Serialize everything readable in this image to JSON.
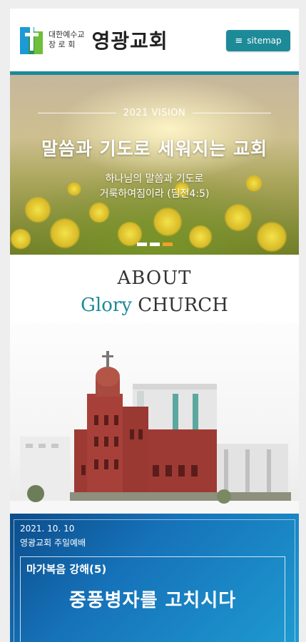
{
  "header": {
    "logo_sub_line1": "대한예수교",
    "logo_sub_line2": "장 로 회",
    "logo_name": "영광교회",
    "sitemap_label": "sitemap"
  },
  "hero": {
    "vision_label": "2021 VISION",
    "title": "말씀과 기도로 세워지는 교회",
    "subtitle_line1": "하나님의 말씀과 기도로",
    "subtitle_line2": "거룩하여짐이라 (딤전4:5)",
    "slide_count": 3,
    "active_slide": 3
  },
  "about": {
    "line1": "ABOUT",
    "glory": "Glory",
    "church": "CHURCH"
  },
  "notice": {
    "date": "2021. 10. 10",
    "service": "영광교회 주일예배",
    "series": "마가복음 강해(5)",
    "title": "중풍병자를 고치시다"
  },
  "colors": {
    "accent": "#1d8a98",
    "slide_active": "#f0a12a",
    "notice_bg": "#1672b9"
  },
  "icons": {
    "menu": "hamburger-icon",
    "logo": "cross-logo-icon"
  }
}
